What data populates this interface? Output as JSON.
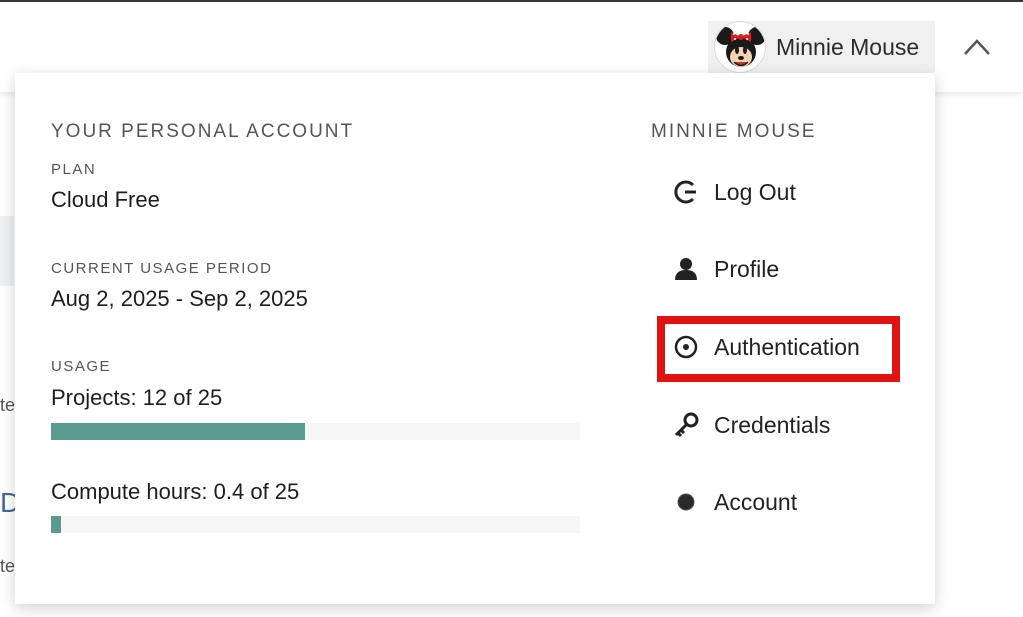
{
  "header": {
    "user_name": "Minnie Mouse"
  },
  "background": {
    "fragment_1": "te",
    "fragment_2": "Da",
    "fragment_3": "te"
  },
  "account_panel": {
    "section_title": "YOUR PERSONAL ACCOUNT",
    "plan_label": "PLAN",
    "plan_value": "Cloud Free",
    "period_label": "CURRENT USAGE PERIOD",
    "period_value": "Aug 2, 2025 - Sep 2, 2025",
    "usage_label": "USAGE",
    "projects_text": "Projects: 12 of 25",
    "projects_used": 12,
    "projects_total": 25,
    "compute_text": "Compute hours: 0.4 of 25",
    "compute_used": 0.4,
    "compute_total": 25,
    "bar_color": "#5a9a8f"
  },
  "user_menu": {
    "title": "MINNIE MOUSE",
    "items": [
      {
        "label": "Log Out",
        "icon": "logout-icon"
      },
      {
        "label": "Profile",
        "icon": "person-icon"
      },
      {
        "label": "Authentication",
        "icon": "target-icon"
      },
      {
        "label": "Credentials",
        "icon": "key-icon"
      },
      {
        "label": "Account",
        "icon": "dot-icon"
      }
    ],
    "highlighted_item": "Authentication",
    "highlight_color": "#e01212"
  }
}
